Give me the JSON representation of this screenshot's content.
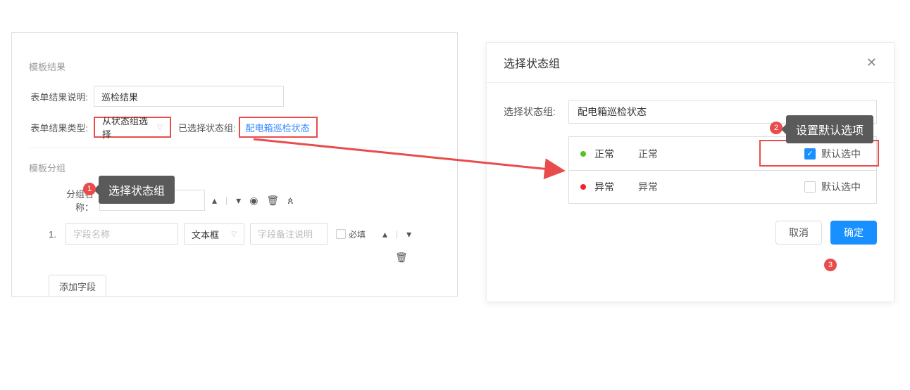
{
  "colors": {
    "accent": "#1890ff",
    "danger": "#e94c4c",
    "green": "#52c41a"
  },
  "left": {
    "section_template_result": "模板结果",
    "result_desc_label": "表单结果说明:",
    "result_desc_value": "巡检结果",
    "result_type_label": "表单结果类型:",
    "result_type_select": "从状态组选择",
    "selected_group_label": "已选择状态组:",
    "selected_group_link": "配电箱巡检状态",
    "section_template_group": "模板分组",
    "group_name_label": "分组名称：",
    "field_index": "1.",
    "field_name_placeholder": "字段名称",
    "field_type_select": "文本框",
    "field_remark_placeholder": "字段备注说明",
    "required_label": "必填",
    "add_field_button": "添加字段"
  },
  "right": {
    "modal_title": "选择状态组",
    "select_group_label": "选择状态组:",
    "select_group_value": "配电箱巡检状态",
    "status1_name": "正常",
    "status1_text": "正常",
    "status1_default": "默认选中",
    "status2_name": "异常",
    "status2_text": "异常",
    "status2_default": "默认选中",
    "cancel": "取消",
    "confirm": "确定"
  },
  "annotations": {
    "badge1": "1",
    "callout1": "选择状态组",
    "badge2": "2",
    "callout2": "设置默认选项",
    "badge3": "3"
  }
}
